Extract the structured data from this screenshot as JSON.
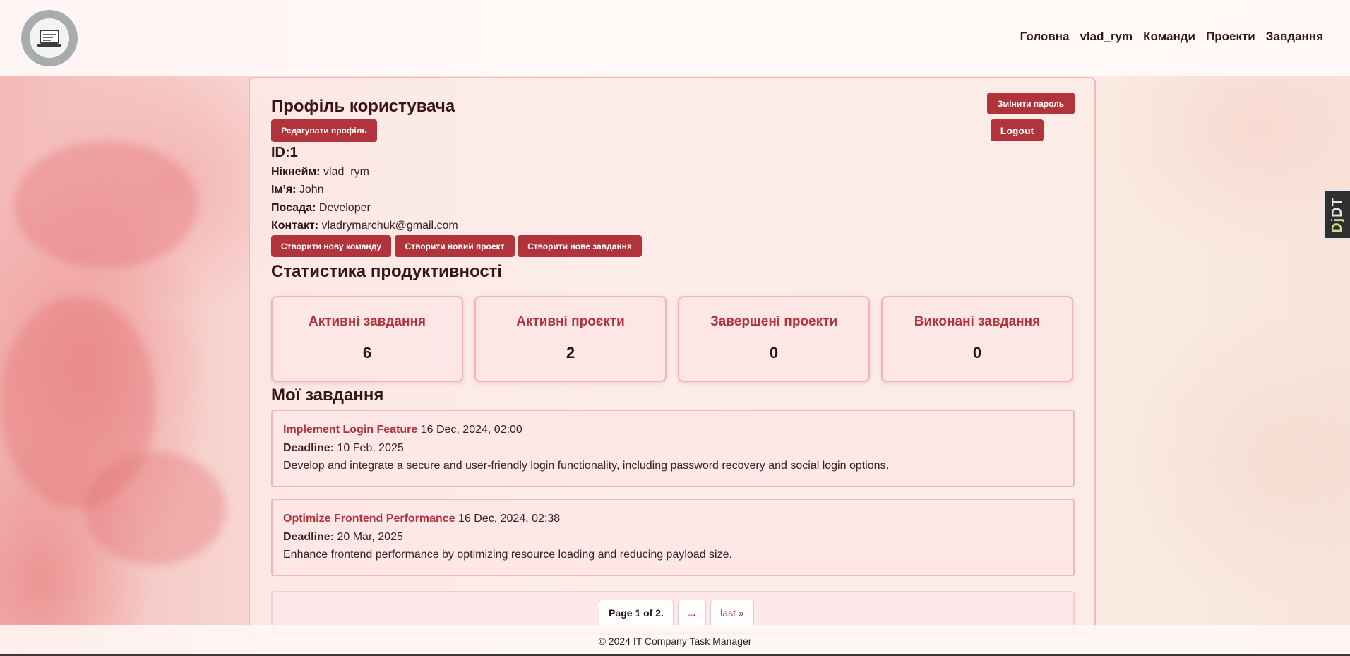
{
  "nav": {
    "items": [
      "Головна",
      "vlad_rym",
      "Команди",
      "Проекти",
      "Завдання"
    ]
  },
  "profile": {
    "title": "Профіль користувача",
    "edit_button": "Редагувати профіль",
    "change_password_button": "Змінити пароль",
    "logout_button": "Logout",
    "id": "ID:1",
    "fields": [
      {
        "label": "Нікнейм:",
        "value": "vlad_rym"
      },
      {
        "label": "Ім’я:",
        "value": "John"
      },
      {
        "label": "Посада:",
        "value": "Developer"
      },
      {
        "label": "Контакт:",
        "value": "vladrymarchuk@gmail.com"
      }
    ],
    "actions": [
      "Створити нову команду",
      "Створити новий проект",
      "Створити нове завдання"
    ]
  },
  "stats": {
    "title": "Статистика продуктивності",
    "cards": [
      {
        "label": "Активні завдання",
        "value": "6"
      },
      {
        "label": "Активні проєкти",
        "value": "2"
      },
      {
        "label": "Завершені проекти",
        "value": "0"
      },
      {
        "label": "Виконані завдання",
        "value": "0"
      }
    ]
  },
  "tasks": {
    "title": "Мої завдання",
    "items": [
      {
        "name": "Implement Login Feature",
        "created": "16 Dec, 2024, 02:00",
        "deadline_label": "Deadline:",
        "deadline": "10 Feb, 2025",
        "description": "Develop and integrate a secure and user-friendly login functionality, including password recovery and social login options."
      },
      {
        "name": "Optimize Frontend Performance",
        "created": "16 Dec, 2024, 02:38",
        "deadline_label": "Deadline:",
        "deadline": "20 Mar, 2025",
        "description": "Enhance frontend performance by optimizing resource loading and reducing payload size."
      }
    ]
  },
  "pagination": {
    "current": "Page 1 of 2.",
    "next": "→",
    "last": "last »"
  },
  "footer": {
    "text": "© 2024 IT Company Task Manager"
  },
  "debug_toolbar": {
    "label_dj": "Dj",
    "label_dt": "DT"
  },
  "colors": {
    "accent": "#b1333b",
    "card_bg": "#fde6e6",
    "card_border": "#f2b5b5"
  }
}
